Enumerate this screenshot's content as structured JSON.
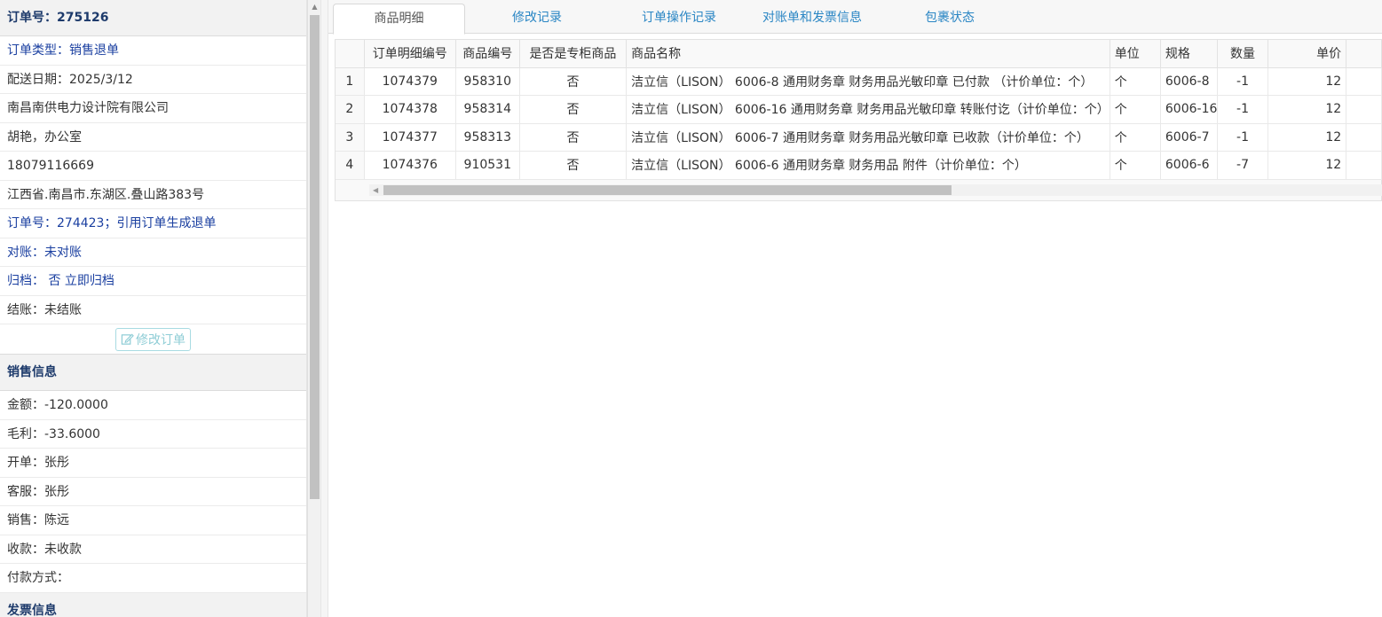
{
  "order": {
    "header": "订单号：275126",
    "type": "订单类型：销售退单",
    "delivery_date": "配送日期：2025/3/12",
    "company": "南昌南供电力设计院有限公司",
    "contact": "胡艳，办公室",
    "phone": "18079116669",
    "address": "江西省.南昌市.东湖区.叠山路383号",
    "ref_order": "订单号：274423；引用订单生成退单",
    "reconcile": "对账：未对账",
    "archive": "归档： 否 立即归档",
    "settle": "结账：未结账",
    "edit_button": "修改订单"
  },
  "sales": {
    "header": "销售信息",
    "amount": "金额：-120.0000",
    "profit": "毛利：-33.6000",
    "issuer": "开单：张彤",
    "service": "客服：张彤",
    "salesperson": "销售：陈远",
    "payment_status": "收款：未收款",
    "payment_method": "付款方式："
  },
  "invoice": {
    "header": "发票信息"
  },
  "tabs": [
    "商品明细",
    "修改记录",
    "订单操作记录",
    "对账单和发票信息",
    "包裹状态"
  ],
  "table": {
    "columns": [
      "订单明细编号",
      "商品编号",
      "是否是专柜商品",
      "商品名称",
      "单位",
      "规格",
      "数量",
      "单价"
    ],
    "rows": [
      {
        "n": "1",
        "detail_id": "1074379",
        "product_id": "958310",
        "special": "否",
        "name": "洁立信（LISON） 6006-8 通用财务章 财务用品光敏印章 已付款 （计价单位：个）",
        "unit": "个",
        "spec": "6006-8",
        "qty": "-1",
        "price": "12"
      },
      {
        "n": "2",
        "detail_id": "1074378",
        "product_id": "958314",
        "special": "否",
        "name": "洁立信（LISON） 6006-16 通用财务章 财务用品光敏印章 转账付讫（计价单位：个）",
        "unit": "个",
        "spec": "6006-16",
        "qty": "-1",
        "price": "12"
      },
      {
        "n": "3",
        "detail_id": "1074377",
        "product_id": "958313",
        "special": "否",
        "name": "洁立信（LISON） 6006-7 通用财务章 财务用品光敏印章 已收款（计价单位：个）",
        "unit": "个",
        "spec": "6006-7",
        "qty": "-1",
        "price": "12"
      },
      {
        "n": "4",
        "detail_id": "1074376",
        "product_id": "910531",
        "special": "否",
        "name": "洁立信（LISON） 6006-6 通用财务章 财务用品 附件（计价单位：个）",
        "unit": "个",
        "spec": "6006-6",
        "qty": "-7",
        "price": "12"
      }
    ]
  }
}
